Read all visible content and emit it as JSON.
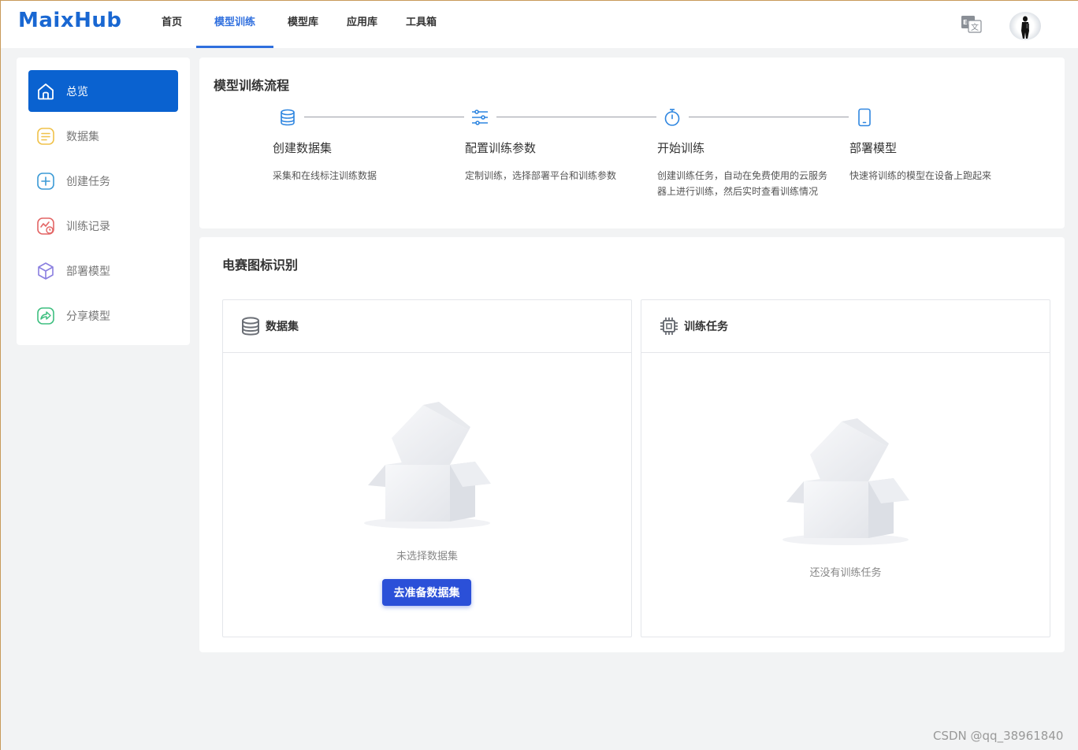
{
  "header": {
    "logo": "MaixHub",
    "nav": [
      {
        "label": "首页"
      },
      {
        "label": "模型训练",
        "active": true
      },
      {
        "label": "模型库"
      },
      {
        "label": "应用库"
      },
      {
        "label": "工具箱"
      }
    ]
  },
  "sidebar": {
    "items": [
      {
        "label": "总览",
        "icon": "home-icon",
        "active": true
      },
      {
        "label": "数据集",
        "icon": "list-icon",
        "color": "#f0c24a"
      },
      {
        "label": "创建任务",
        "icon": "plus-square-icon",
        "color": "#3b9ad6"
      },
      {
        "label": "训练记录",
        "icon": "chart-clock-icon",
        "color": "#e36565"
      },
      {
        "label": "部署模型",
        "icon": "cube-icon",
        "color": "#8a7fe0"
      },
      {
        "label": "分享模型",
        "icon": "share-icon",
        "color": "#3fbf80"
      }
    ]
  },
  "flow": {
    "title": "模型训练流程",
    "steps": [
      {
        "title": "创建数据集",
        "desc": "采集和在线标注训练数据",
        "icon": "database-icon"
      },
      {
        "title": "配置训练参数",
        "desc": "定制训练，选择部署平台和训练参数",
        "icon": "sliders-icon"
      },
      {
        "title": "开始训练",
        "desc": "创建训练任务，自动在免费使用的云服务器上进行训练，然后实时查看训练情况",
        "icon": "stopwatch-icon"
      },
      {
        "title": "部署模型",
        "desc": "快速将训练的模型在设备上跑起来",
        "icon": "mobile-icon"
      }
    ]
  },
  "project": {
    "title": "电赛图标识别",
    "dataset_panel": {
      "title": "数据集",
      "empty_text": "未选择数据集",
      "button": "去准备数据集"
    },
    "task_panel": {
      "title": "训练任务",
      "empty_text": "还没有训练任务"
    }
  },
  "watermark": "CSDN @qq_38961840",
  "colors": {
    "primary": "#0a62d0",
    "nav_active": "#2f6fde",
    "button": "#2b50d8"
  }
}
